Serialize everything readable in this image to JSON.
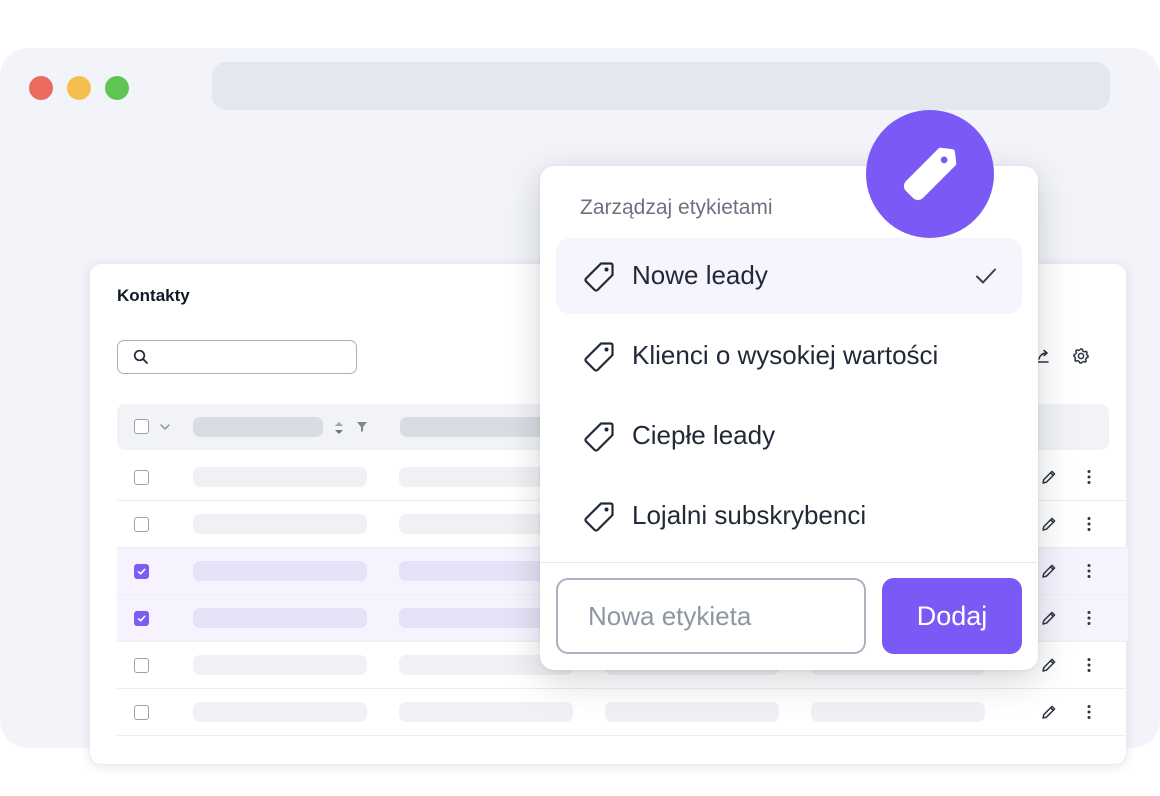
{
  "window": {
    "controls": [
      "close",
      "minimize",
      "maximize"
    ],
    "address": ""
  },
  "contacts": {
    "title": "Kontakty",
    "search": {
      "value": "",
      "placeholder": ""
    },
    "toolbar_icons": [
      "export-icon",
      "gear-icon"
    ],
    "table": {
      "header_icons": [
        "sort-icon",
        "filter-icon",
        "chevron-down-icon"
      ],
      "rows": [
        {
          "checked": false
        },
        {
          "checked": false
        },
        {
          "checked": true
        },
        {
          "checked": true
        },
        {
          "checked": false
        },
        {
          "checked": false
        }
      ],
      "row_icons": [
        "pencil-icon",
        "more-vertical-icon"
      ]
    }
  },
  "label_manager": {
    "title": "Zarządzaj etykietami",
    "badge_icon": "tag-icon",
    "items": [
      {
        "label": "Nowe leady",
        "selected": true
      },
      {
        "label": "Klienci o wysokiej wartości",
        "selected": false
      },
      {
        "label": "Ciepłe leady",
        "selected": false
      },
      {
        "label": "Lojalni subskrybenci",
        "selected": false
      }
    ],
    "new_label": {
      "value": "",
      "placeholder": "Nowa etykieta"
    },
    "add_button": "Dodaj"
  },
  "colors": {
    "accent": "#7a59f5",
    "selected_row": "#f6f3fe",
    "window_bg": "#f2f4f9"
  }
}
